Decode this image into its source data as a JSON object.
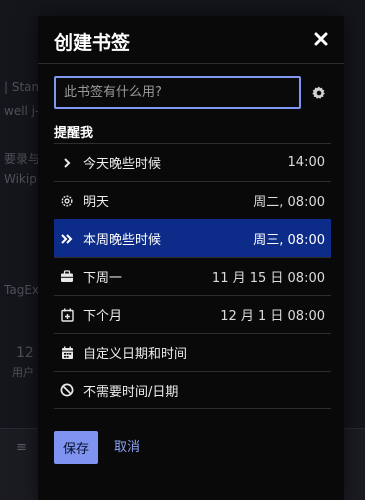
{
  "background": {
    "fragments": [
      "| Stam",
      "well j-",
      "要录与",
      "Wikip",
      "TagEx",
      "12",
      "用户"
    ]
  },
  "modal": {
    "title": "创建书签"
  },
  "search": {
    "value": "",
    "placeholder": "此书签有什么用?"
  },
  "remind": {
    "label": "提醒我",
    "options": [
      {
        "label": "今天晚些时候",
        "value": "14:00",
        "icon": "chevron-right-icon",
        "selected": false
      },
      {
        "label": "明天",
        "value": "周二, 08:00",
        "icon": "gear-icon",
        "selected": false
      },
      {
        "label": "本周晚些时候",
        "value": "周三, 08:00",
        "icon": "double-chevron-right-icon",
        "selected": true
      },
      {
        "label": "下周一",
        "value": "11 月 15 日 08:00",
        "icon": "briefcase-icon",
        "selected": false
      },
      {
        "label": "下个月",
        "value": "12 月 1 日 08:00",
        "icon": "calendar-plus-icon",
        "selected": false
      },
      {
        "label": "自定义日期和时间",
        "value": "",
        "icon": "calendar-grid-icon",
        "selected": false
      },
      {
        "label": "不需要时间/日期",
        "value": "",
        "icon": "ban-icon",
        "selected": false
      }
    ]
  },
  "actions": {
    "save_label": "保存",
    "cancel_label": "取消"
  },
  "colors": {
    "accent": "#7e94f0",
    "selected_row": "#0d2c8a",
    "modal_bg": "#090909"
  }
}
